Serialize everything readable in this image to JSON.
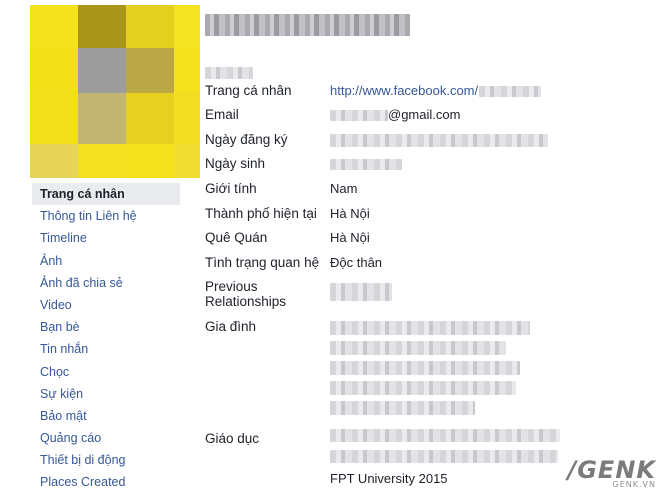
{
  "nav": {
    "items": [
      {
        "label": "Trang cá nhân",
        "active": true
      },
      {
        "label": "Thông tin Liên hệ"
      },
      {
        "label": "Timeline"
      },
      {
        "label": "Ảnh"
      },
      {
        "label": "Ảnh đã chia sẻ"
      },
      {
        "label": "Video"
      },
      {
        "label": "Bạn bè"
      },
      {
        "label": "Tin nhắn"
      },
      {
        "label": "Chọc"
      },
      {
        "label": "Sự kiện"
      },
      {
        "label": "Bảo mật"
      },
      {
        "label": "Quảng cáo"
      },
      {
        "label": "Thiết bị di động"
      },
      {
        "label": "Places Created"
      }
    ]
  },
  "info": {
    "profile_label": "Trang cá nhân",
    "profile_url": "http://www.facebook.com/",
    "email_label": "Email",
    "email_suffix": "@gmail.com",
    "registered_label": "Ngày đăng ký",
    "birthday_label": "Ngày sinh",
    "gender_label": "Giới tính",
    "gender_value": "Nam",
    "city_label": "Thành phố hiện tại",
    "city_value": "Hà Nội",
    "hometown_label": "Quê Quán",
    "hometown_value": "Hà Nội",
    "relationship_label": "Tình trạng quan hệ",
    "relationship_value": "Độc thân",
    "prev_rel_label_1": "Previous",
    "prev_rel_label_2": "Relationships",
    "family_label": "Gia đình",
    "education_label": "Giáo dục",
    "education_partial": "FPT University 2015"
  },
  "watermark": {
    "brand": "GENK",
    "sub": "GENK.VN"
  },
  "colors": {
    "link": "#365899",
    "active_bg": "#e9ebee",
    "avatar_yellow": "#f4e11a"
  }
}
